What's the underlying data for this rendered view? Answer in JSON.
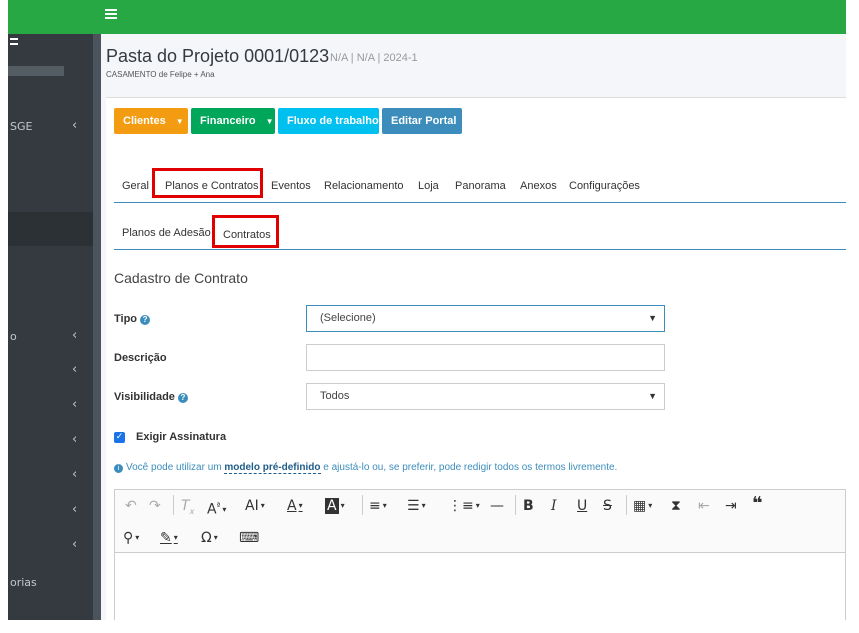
{
  "page": {
    "title": "Pasta do Projeto 0001/0123",
    "meta": "N/A | N/A | 2024-1",
    "subtitle": "CASAMENTO de Felipe + Ana"
  },
  "sidebar": {
    "items": [
      {
        "label": "SGE"
      },
      {
        "label": "o"
      },
      {
        "label": "orias"
      }
    ]
  },
  "buttons": {
    "clientes": "Clientes",
    "financeiro": "Financeiro",
    "fluxo": "Fluxo de trabalho",
    "editar_portal": "Editar Portal"
  },
  "tabs": [
    "Geral",
    "Planos e Contratos",
    "Eventos",
    "Relacionamento",
    "Loja",
    "Panorama",
    "Anexos",
    "Configurações"
  ],
  "subtabs": [
    "Planos de Adesão",
    "Contratos"
  ],
  "form": {
    "section_title": "Cadastro de Contrato",
    "tipo_label": "Tipo",
    "tipo_value": "(Selecione)",
    "descricao_label": "Descrição",
    "visibilidade_label": "Visibilidade",
    "visibilidade_value": "Todos",
    "exigir_assinatura": "Exigir Assinatura",
    "info_before": "Você pode utilizar um ",
    "info_link": "modelo pré-definido",
    "info_after": " e ajustá-lo ou, se preferir, pode redigir todos os termos livremente."
  },
  "colors": {
    "topbar": "#28a745",
    "sidebar": "#343a40",
    "highlight": "#e00000",
    "orange": "#f39c12",
    "green": "#00a65a",
    "cyan": "#00c0ef",
    "blue": "#3c8dbc"
  }
}
